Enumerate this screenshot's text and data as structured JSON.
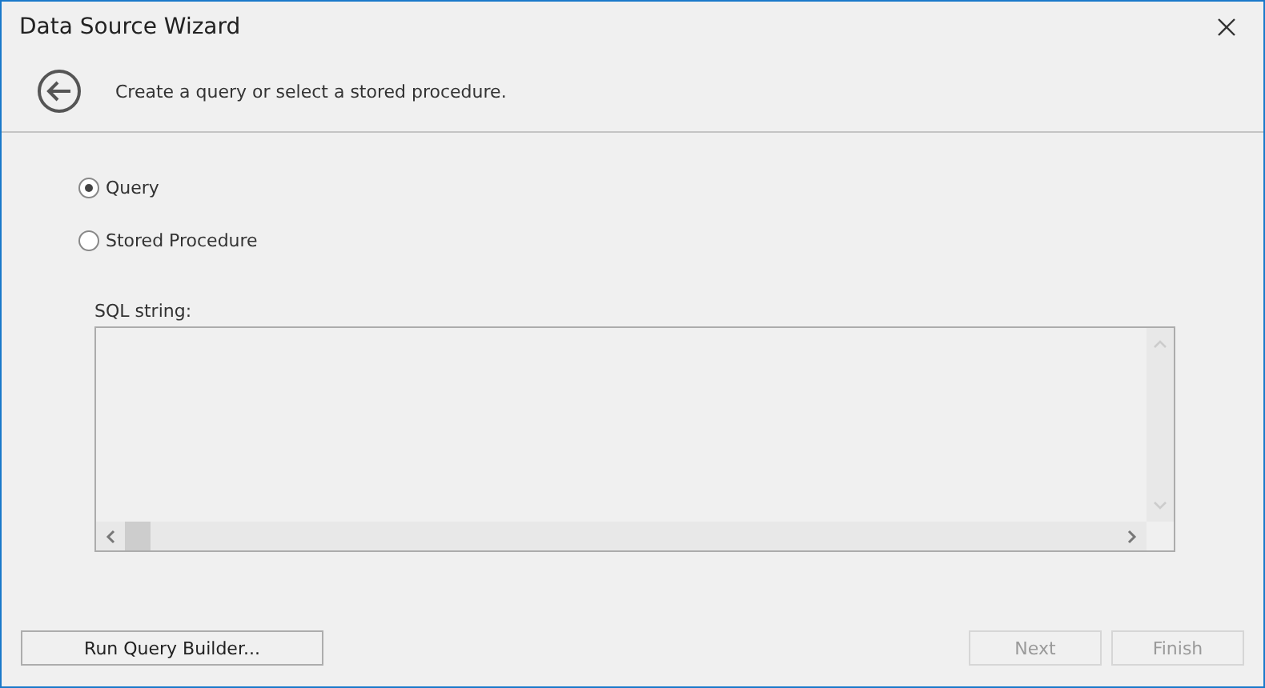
{
  "window": {
    "title": "Data Source Wizard"
  },
  "header": {
    "text": "Create a query or select a stored procedure."
  },
  "options": [
    {
      "label": "Query",
      "selected": true
    },
    {
      "label": "Stored Procedure",
      "selected": false
    }
  ],
  "sql": {
    "label": "SQL string:"
  },
  "buttons": [
    {
      "label": "Run Query Builder...",
      "disabled": false
    },
    {
      "label": "Next",
      "disabled": true
    },
    {
      "label": "Finish",
      "disabled": true
    }
  ]
}
